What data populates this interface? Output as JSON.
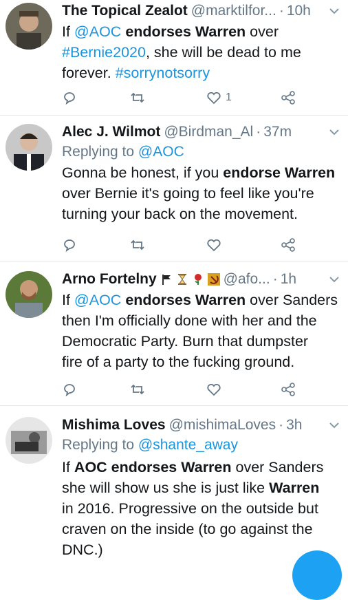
{
  "colors": {
    "link": "#1b95e0",
    "muted": "#657786",
    "text": "#14171a",
    "divider": "#e1e8ed",
    "fab": "#1da1f2"
  },
  "tweets": [
    {
      "name": "The Topical Zealot",
      "handle": "@marktilfor...",
      "dot": "·",
      "time": "10h",
      "avatar_icon": "avatar-photo",
      "body": {
        "p1": "If ",
        "m1": "@AOC",
        "p2": " ",
        "b1": "endorses Warren",
        "p3": " over",
        "h1": "#Bernie2020",
        "p4": ", she will be dead to me",
        "p5": "forever. ",
        "h2": "#sorrynotsorry"
      },
      "like_count": "1"
    },
    {
      "name": "Alec J. Wilmot",
      "handle": "@Birdman_Al",
      "dot": "·",
      "time": "37m",
      "avatar_icon": "avatar-photo",
      "replying_prefix": "Replying to ",
      "replying_handle": "@AOC",
      "body": {
        "p1": "Gonna be honest, if you ",
        "b1": "endorse Warren",
        "p2": "over Bernie it's going to feel like you're",
        "p3": "turning your back on the movement."
      }
    },
    {
      "name": "Arno Fortelny",
      "handle": "@afo...",
      "dot": "·",
      "time": "1h",
      "avatar_icon": "avatar-photo",
      "name_emojis": [
        "flag-emoji",
        "hourglass-emoji",
        "rose-emoji",
        "hammer-sickle-emoji"
      ],
      "body": {
        "p1": "If ",
        "m1": "@AOC",
        "p2": " ",
        "b1": "endorses Warren",
        "p3": " over Sanders",
        "p4": "then I'm officially done with her and the",
        "p5": "Democratic Party. Burn that dumpster",
        "p6": "fire of a party to the fucking ground."
      }
    },
    {
      "name": "Mishima Loves",
      "handle": "@mishimaLoves",
      "dot": "·",
      "time": "3h",
      "avatar_icon": "avatar-photo",
      "replying_prefix": "Replying to ",
      "replying_handle": "@shante_away",
      "body": {
        "p1": "If ",
        "b1": "AOC endorses Warren",
        "p2": " over Sanders",
        "p3": "she will show us she is just like ",
        "b2": "Warren",
        "p4": "in 2016. Progressive on the outside but",
        "p5": "craven on the inside (to go against the",
        "p6": "DNC.)"
      }
    }
  ]
}
